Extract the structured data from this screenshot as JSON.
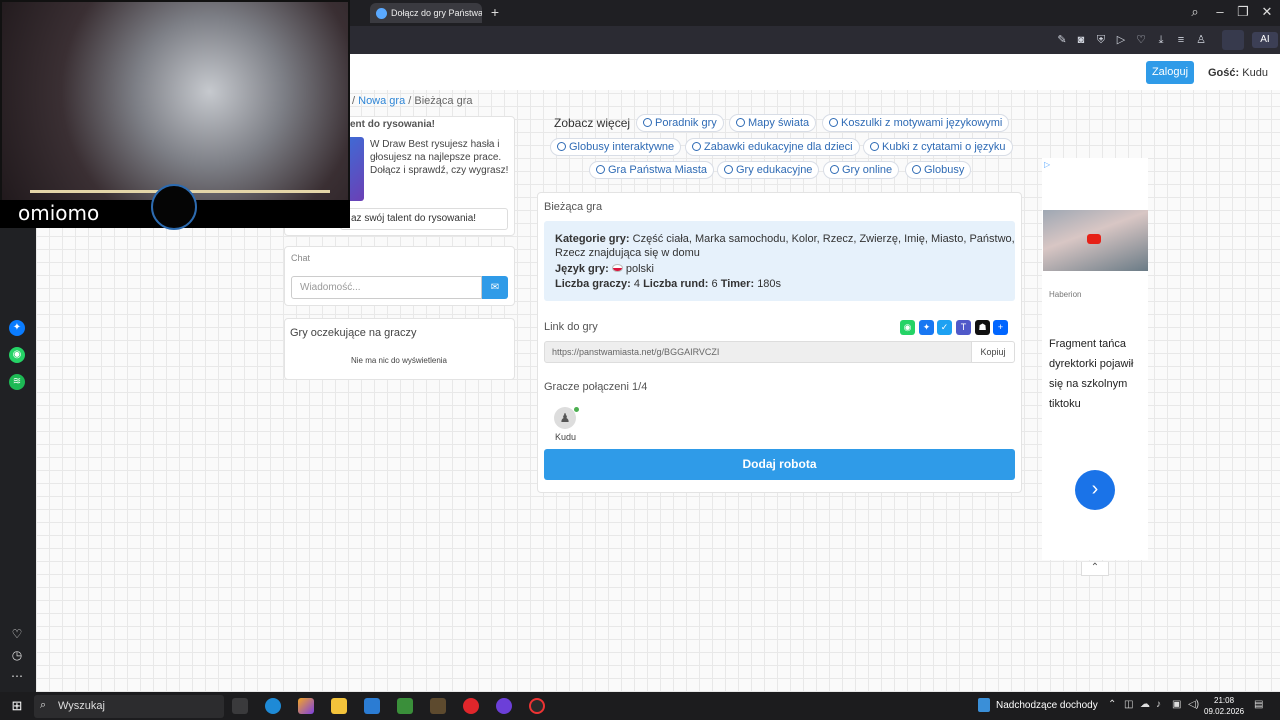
{
  "browser": {
    "tab_title": "Dołącz do gry Państwa M",
    "new_tab": "+",
    "ai_label": "AI"
  },
  "header": {
    "login_label": "Zaloguj",
    "guest_label": "Gość:",
    "guest_name": "Kudu"
  },
  "breadcrumb": {
    "prefix": "/",
    "new_game": "Nowa gra",
    "separator": "/",
    "current": "Bieżąca gra"
  },
  "promo": {
    "title": "ent do rysowania!",
    "text": "W Draw Best rysujesz hasła i głosujesz na najlepsze prace. Dołącz i sprawdź, czy wygrasz!",
    "button": "az swój talent do rysowania!"
  },
  "chat": {
    "label": "Chat",
    "placeholder": "Wiadomość..."
  },
  "waiting": {
    "title": "Gry oczekujące na graczy",
    "empty": "Nie ma nic do wyświetlenia"
  },
  "see_more": {
    "label": "Zobacz więcej",
    "links": [
      "Poradnik gry",
      "Mapy świata",
      "Koszulki z motywami językowymi",
      "Globusy interaktywne",
      "Zabawki edukacyjne dla dzieci",
      "Kubki z cytatami o języku",
      "Gra Państwa Miasta",
      "Gry edukacyjne",
      "Gry online",
      "Globusy"
    ]
  },
  "game": {
    "title": "Bieżąca gra",
    "categories_label": "Kategorie gry:",
    "categories_line1": "Część ciała, Marka samochodu, Kolor, Rzecz, Zwierzę, Imię, Miasto, Państwo,",
    "categories_line2": "Rzecz znajdująca się w domu",
    "language_label": "Język gry:",
    "language": "polski",
    "players_label": "Liczba graczy:",
    "players": "4",
    "rounds_label": "Liczba rund:",
    "rounds": "6",
    "timer_label": "Timer:",
    "timer": "180s",
    "link_label": "Link do gry",
    "link_url": "https://panstwamiasta.net/g/BGGAIRVCZI",
    "copy_label": "Kopiuj",
    "connected_label": "Gracze połączeni 1/4",
    "player_name": "Kudu",
    "add_bot": "Dodaj robota"
  },
  "ad": {
    "marker": "▷",
    "source": "Haberion",
    "text": "Fragment tańca dyrektorki pojawił się na szkolnym tiktoku",
    "next": "›",
    "collapse": "⌃"
  },
  "webcam": {
    "name": "omiomo"
  },
  "taskbar": {
    "search": "Wyszukaj",
    "weather": "Nadchodzące dochody",
    "time": "21:08",
    "date": "09.02.2026"
  },
  "colors": {
    "accent": "#2f9be8",
    "link": "#2f6bb5",
    "info_bg": "#e6f1fb"
  }
}
